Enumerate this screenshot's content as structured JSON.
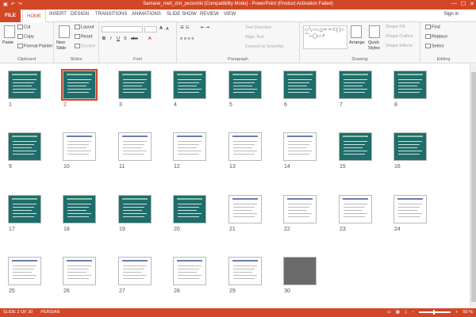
{
  "titlebar": {
    "title": "Samane_meli_zist_pezeshki [Compatibility Mode] - PowerPoint (Product Activation Failed)",
    "minimize": "—",
    "maximize": "☐",
    "close": "✕"
  },
  "tabs": {
    "file": "FILE",
    "items": [
      "HOME",
      "INSERT",
      "DESIGN",
      "TRANSITIONS",
      "ANIMATIONS",
      "SLIDE SHOW",
      "REVIEW",
      "VIEW"
    ],
    "signin": "Sign in"
  },
  "ribbon": {
    "clipboard": {
      "paste": "Paste",
      "cut": "Cut",
      "copy": "Copy",
      "format_painter": "Format Painter",
      "label": "Clipboard"
    },
    "slides": {
      "new_slide": "New Slide",
      "layout": "Layout",
      "reset": "Reset",
      "section": "Section",
      "label": "Slides"
    },
    "font": {
      "label": "Font"
    },
    "paragraph": {
      "text_direction": "Text Direction",
      "align_text": "Align Text",
      "convert": "Convert to SmartArt",
      "label": "Paragraph"
    },
    "drawing": {
      "arrange": "Arrange",
      "quick_styles": "Quick Styles",
      "shape_fill": "Shape Fill",
      "shape_outline": "Shape Outline",
      "shape_effects": "Shape Effects",
      "label": "Drawing"
    },
    "editing": {
      "find": "Find",
      "replace": "Replace",
      "select": "Select",
      "label": "Editing"
    }
  },
  "slides": [
    {
      "n": "1"
    },
    {
      "n": "2",
      "selected": true
    },
    {
      "n": "3"
    },
    {
      "n": "4"
    },
    {
      "n": "5"
    },
    {
      "n": "6"
    },
    {
      "n": "7"
    },
    {
      "n": "8"
    },
    {
      "n": "9"
    },
    {
      "n": "10"
    },
    {
      "n": "11"
    },
    {
      "n": "12"
    },
    {
      "n": "13"
    },
    {
      "n": "14"
    },
    {
      "n": "15"
    },
    {
      "n": "16"
    },
    {
      "n": "17"
    },
    {
      "n": "18"
    },
    {
      "n": "19"
    },
    {
      "n": "20"
    },
    {
      "n": "21"
    },
    {
      "n": "22"
    },
    {
      "n": "23"
    },
    {
      "n": "24"
    },
    {
      "n": "25"
    },
    {
      "n": "26"
    },
    {
      "n": "27"
    },
    {
      "n": "28"
    },
    {
      "n": "29"
    },
    {
      "n": "30"
    }
  ],
  "status": {
    "slide": "SLIDE 2 OF 30",
    "language": "PERSIAN",
    "zoom": "50 %"
  },
  "colors": {
    "accent": "#d24726",
    "slide_bg": "#1f6e6b"
  }
}
